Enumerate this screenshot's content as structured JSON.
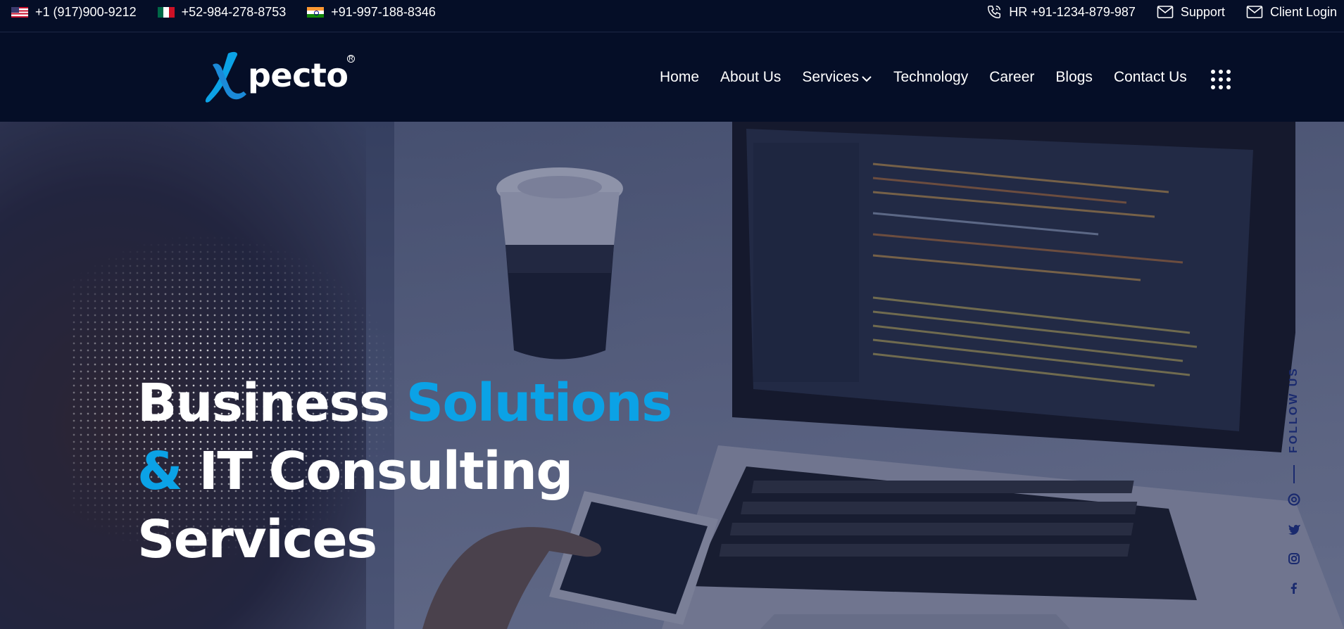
{
  "topbar": {
    "phones": [
      {
        "flag": "us-flag-icon",
        "number": "+1 (917)900-9212"
      },
      {
        "flag": "mexico-flag-icon",
        "number": "+52-984-278-8753"
      },
      {
        "flag": "india-flag-icon",
        "number": "+91-997-188-8346"
      }
    ],
    "hr": "HR +91-1234-879-987",
    "support": "Support",
    "client_login": "Client Login"
  },
  "brand": {
    "name": "pecto",
    "logo_letter": "X"
  },
  "nav": {
    "items": [
      "Home",
      "About Us",
      "Services",
      "Technology",
      "Career",
      "Blogs",
      "Contact Us"
    ]
  },
  "hero": {
    "line1_white": "Business",
    "line1_blue": "Solutions",
    "line2_blue": "&",
    "line2_white": "IT Consulting",
    "line3_white": "Services"
  },
  "social": {
    "label": "FOLLOW US",
    "icons": [
      "email-icon",
      "twitter-icon",
      "instagram-icon",
      "facebook-icon"
    ]
  },
  "colors": {
    "accent": "#0ba2e6",
    "background": "#050e27",
    "social": "#1a2a6e"
  }
}
